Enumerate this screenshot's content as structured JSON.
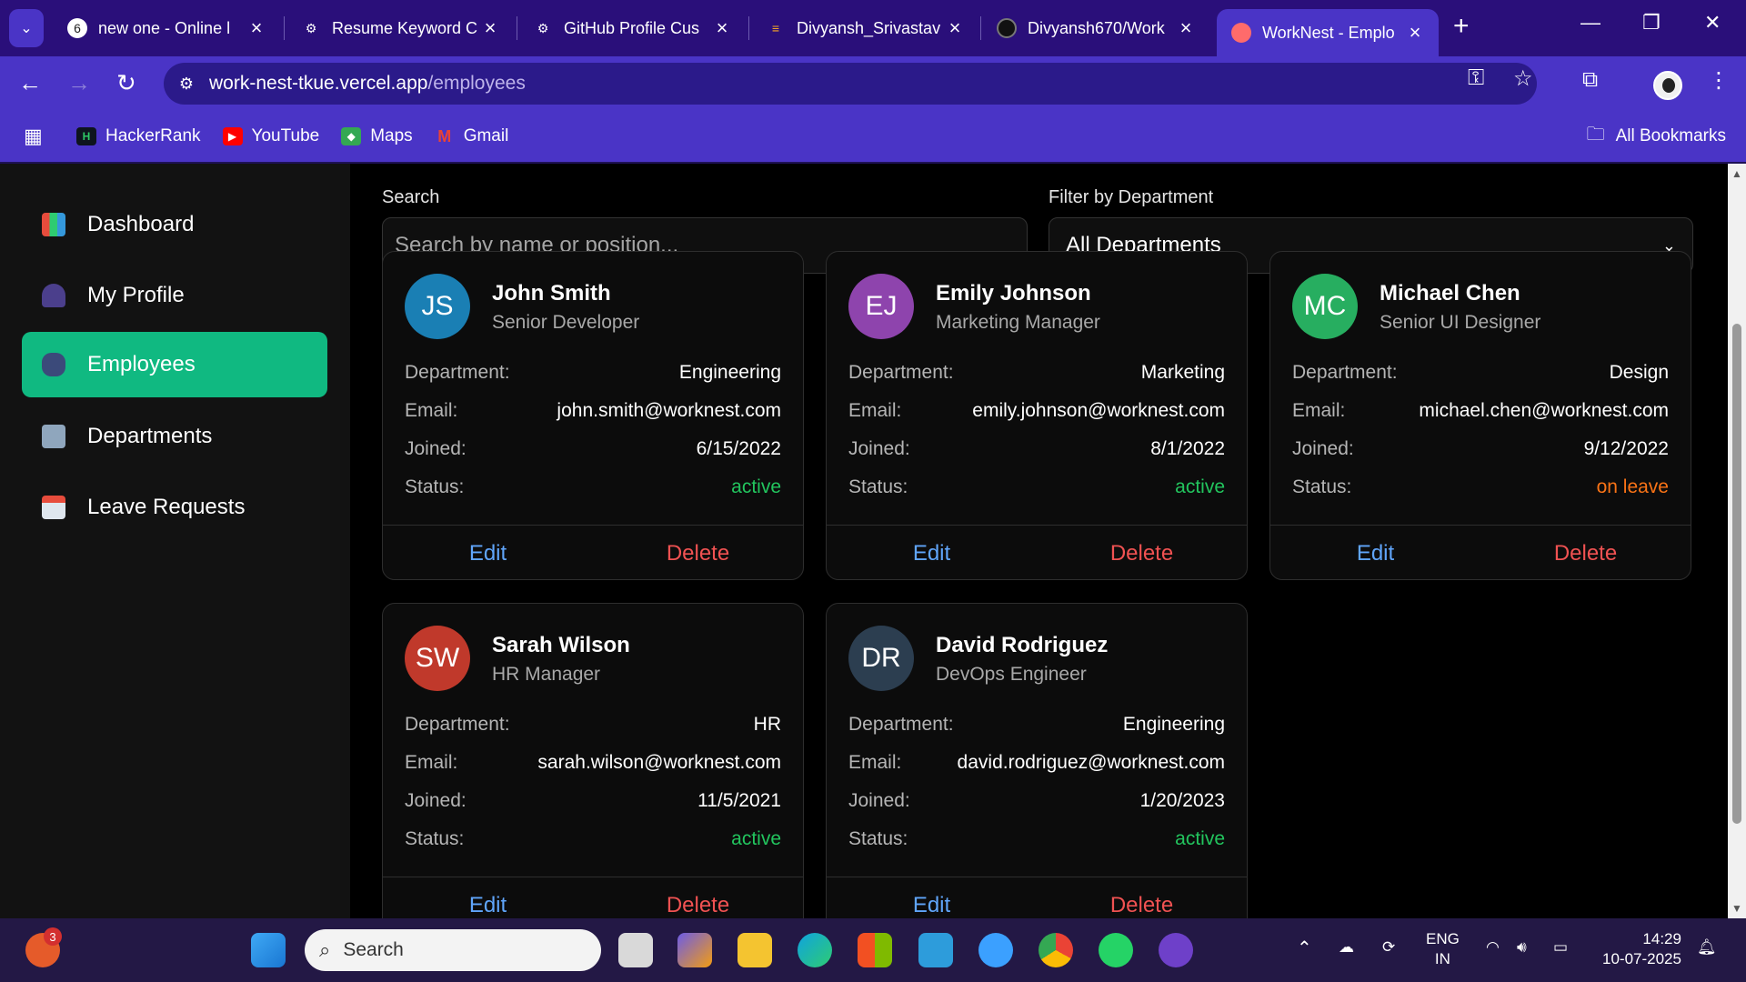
{
  "browser": {
    "tabs": [
      {
        "title": "new one - Online l",
        "active": false
      },
      {
        "title": "Resume Keyword C",
        "active": false
      },
      {
        "title": "GitHub Profile Cus",
        "active": false
      },
      {
        "title": "Divyansh_Srivastav",
        "active": false
      },
      {
        "title": "Divyansh670/Work",
        "active": false
      },
      {
        "title": "WorkNest - Emplo",
        "active": true
      }
    ],
    "url_host": "work-nest-tkue.vercel.app",
    "url_path": "/employees",
    "bookmarks": [
      {
        "label": "HackerRank",
        "icon": "hackerrank-icon"
      },
      {
        "label": "YouTube",
        "icon": "youtube-icon"
      },
      {
        "label": "Maps",
        "icon": "maps-icon"
      },
      {
        "label": "Gmail",
        "icon": "gmail-icon"
      }
    ],
    "all_bookmarks": "All Bookmarks"
  },
  "sidebar": {
    "items": [
      {
        "label": "Dashboard",
        "icon": "chart-icon",
        "active": false
      },
      {
        "label": "My Profile",
        "icon": "user-icon",
        "active": false
      },
      {
        "label": "Employees",
        "icon": "users-icon",
        "active": true
      },
      {
        "label": "Departments",
        "icon": "building-icon",
        "active": false
      },
      {
        "label": "Leave Requests",
        "icon": "calendar-icon",
        "active": false
      }
    ]
  },
  "filters": {
    "search_label": "Search",
    "search_placeholder": "Search by name or position...",
    "dept_label": "Filter by Department",
    "dept_selected": "All Departments"
  },
  "labels": {
    "department": "Department:",
    "email": "Email:",
    "joined": "Joined:",
    "status": "Status:",
    "edit": "Edit",
    "delete": "Delete"
  },
  "employees": [
    {
      "initials": "JS",
      "name": "John Smith",
      "position": "Senior Developer",
      "department": "Engineering",
      "email": "john.smith@worknest.com",
      "joined": "6/15/2022",
      "status": "active",
      "avatar_color": "#1a7fb4"
    },
    {
      "initials": "EJ",
      "name": "Emily Johnson",
      "position": "Marketing Manager",
      "department": "Marketing",
      "email": "emily.johnson@worknest.com",
      "joined": "8/1/2022",
      "status": "active",
      "avatar_color": "#8e44ad"
    },
    {
      "initials": "MC",
      "name": "Michael Chen",
      "position": "Senior UI Designer",
      "department": "Design",
      "email": "michael.chen@worknest.com",
      "joined": "9/12/2022",
      "status": "on leave",
      "avatar_color": "#27ae60"
    },
    {
      "initials": "SW",
      "name": "Sarah Wilson",
      "position": "HR Manager",
      "department": "HR",
      "email": "sarah.wilson@worknest.com",
      "joined": "11/5/2021",
      "status": "active",
      "avatar_color": "#c0392b"
    },
    {
      "initials": "DR",
      "name": "David Rodriguez",
      "position": "DevOps Engineer",
      "department": "Engineering",
      "email": "david.rodriguez@worknest.com",
      "joined": "1/20/2023",
      "status": "active",
      "avatar_color": "#2c3e50"
    }
  ],
  "taskbar": {
    "search_label": "Search",
    "notification_count": "3",
    "lang": "ENG",
    "region": "IN",
    "time": "14:29",
    "date": "10-07-2025"
  },
  "colors": {
    "accent": "#10b981",
    "chrome": "#4a34c6",
    "status_active": "#22c55e",
    "status_leave": "#f97316"
  }
}
